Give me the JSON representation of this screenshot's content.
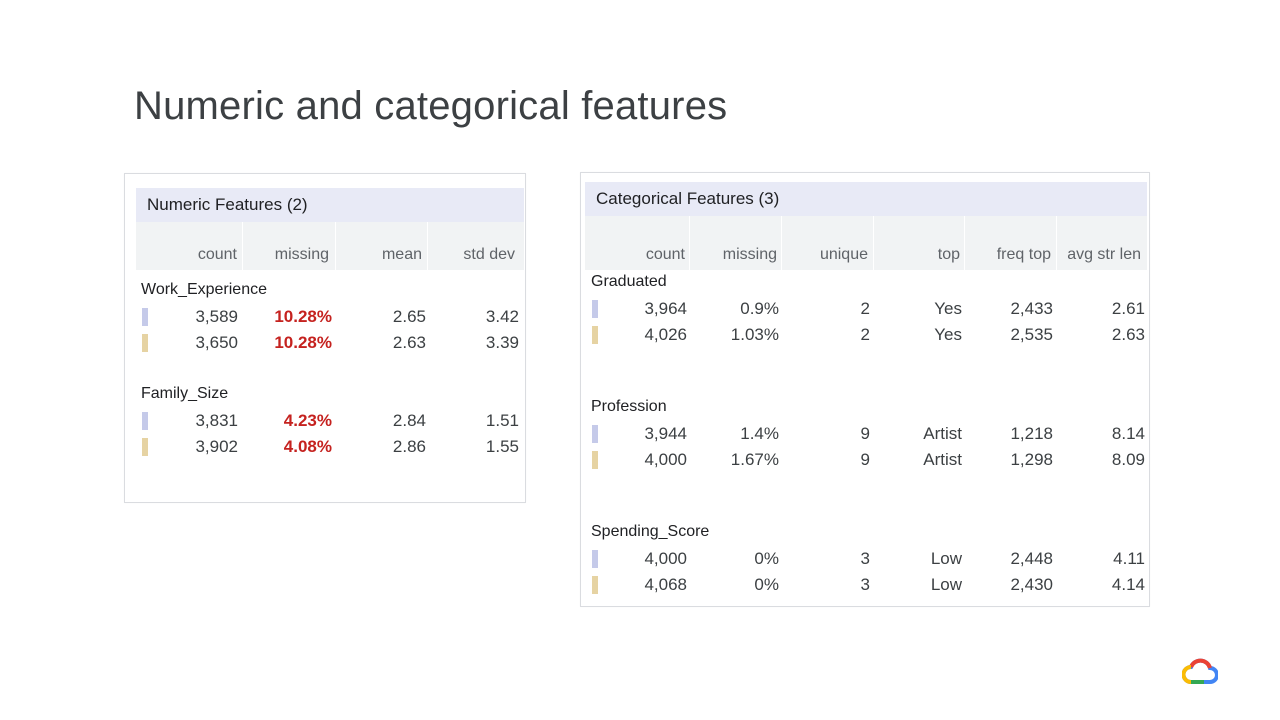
{
  "slide": {
    "title": "Numeric and categorical features"
  },
  "numeric": {
    "header": "Numeric Features (2)",
    "columns": [
      "count",
      "missing",
      "mean",
      "std dev"
    ],
    "features": [
      {
        "name": "Work_Experience",
        "rows": [
          {
            "swatch": "#c5cae9",
            "count": "3,589",
            "missing": "10.28%",
            "mean": "2.65",
            "std": "3.42"
          },
          {
            "swatch": "#e6d3a3",
            "count": "3,650",
            "missing": "10.28%",
            "mean": "2.63",
            "std": "3.39"
          }
        ]
      },
      {
        "name": "Family_Size",
        "rows": [
          {
            "swatch": "#c5cae9",
            "count": "3,831",
            "missing": "4.23%",
            "mean": "2.84",
            "std": "1.51"
          },
          {
            "swatch": "#e6d3a3",
            "count": "3,902",
            "missing": "4.08%",
            "mean": "2.86",
            "std": "1.55"
          }
        ]
      }
    ]
  },
  "categorical": {
    "header": "Categorical Features (3)",
    "columns": [
      "count",
      "missing",
      "unique",
      "top",
      "freq top",
      "avg str len"
    ],
    "features": [
      {
        "name": "Graduated",
        "rows": [
          {
            "swatch": "#c5cae9",
            "count": "3,964",
            "missing": "0.9%",
            "unique": "2",
            "top": "Yes",
            "freq": "2,433",
            "avg": "2.61"
          },
          {
            "swatch": "#e6d3a3",
            "count": "4,026",
            "missing": "1.03%",
            "unique": "2",
            "top": "Yes",
            "freq": "2,535",
            "avg": "2.63"
          }
        ]
      },
      {
        "name": "Profession",
        "rows": [
          {
            "swatch": "#c5cae9",
            "count": "3,944",
            "missing": "1.4%",
            "unique": "9",
            "top": "Artist",
            "freq": "1,218",
            "avg": "8.14"
          },
          {
            "swatch": "#e6d3a3",
            "count": "4,000",
            "missing": "1.67%",
            "unique": "9",
            "top": "Artist",
            "freq": "1,298",
            "avg": "8.09"
          }
        ]
      },
      {
        "name": "Spending_Score",
        "rows": [
          {
            "swatch": "#c5cae9",
            "count": "4,000",
            "missing": "0%",
            "unique": "3",
            "top": "Low",
            "freq": "2,448",
            "avg": "4.11"
          },
          {
            "swatch": "#e6d3a3",
            "count": "4,068",
            "missing": "0%",
            "unique": "3",
            "top": "Low",
            "freq": "2,430",
            "avg": "4.14"
          }
        ]
      }
    ]
  },
  "logo": {
    "icon": "google-cloud-logo",
    "colors": [
      "#ea4335",
      "#4285f4",
      "#fbbc04",
      "#34a853"
    ]
  }
}
